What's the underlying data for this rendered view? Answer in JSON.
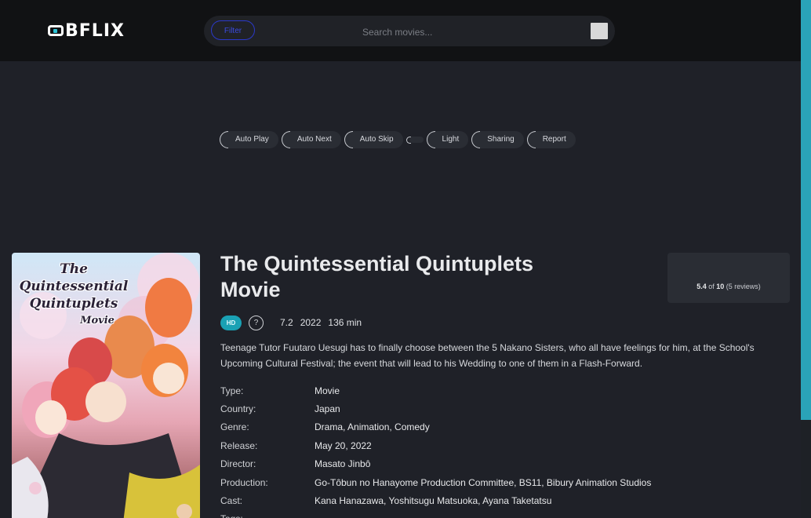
{
  "header": {
    "logo_text": "BFLIX",
    "filter_label": "Filter",
    "search_placeholder": "Search movies..."
  },
  "controls": [
    {
      "label": "Auto Play"
    },
    {
      "label": "Auto Next"
    },
    {
      "label": "Auto Skip"
    },
    {
      "label": "Light"
    },
    {
      "label": "Sharing"
    },
    {
      "label": "Report"
    }
  ],
  "poster": {
    "title_line1": "The",
    "title_line2": "Quintessential",
    "title_line3": "Quintuplets",
    "title_line4": "Movie"
  },
  "movie": {
    "title": "The Quintessential Quintuplets Movie",
    "quality": "HD",
    "badge_q": "?",
    "rating": "7.2",
    "year": "2022",
    "duration": "136 min",
    "description": "Teenage Tutor Fuutaro Uesugi has to finally choose between the 5 Nakano Sisters, who all have feelings for him, at the School's Upcoming Cultural Festival; the event that will lead to his Wedding to one of them in a Flash-Forward.",
    "info": [
      {
        "key": "Type:",
        "value": "Movie"
      },
      {
        "key": "Country:",
        "value": "Japan"
      },
      {
        "key": "Genre:",
        "value": "Drama, Animation, Comedy"
      },
      {
        "key": "Release:",
        "value": "May 20, 2022"
      },
      {
        "key": "Director:",
        "value": "Masato Jinbô"
      },
      {
        "key": "Production:",
        "value": "Go-Tôbun no Hanayome Production Committee, BS11, Bibury Animation Studios"
      },
      {
        "key": "Cast:",
        "value": "Kana Hanazawa, Yoshitsugu Matsuoka, Ayana Taketatsu"
      },
      {
        "key": "Tags:",
        "value": ""
      }
    ]
  },
  "user_rating": {
    "score": "5.4",
    "of_text": "of",
    "max": "10",
    "reviews": "(5 reviews)"
  },
  "colors": {
    "accent": "#1aa1b4",
    "background": "#1f2128",
    "header": "#111214"
  }
}
